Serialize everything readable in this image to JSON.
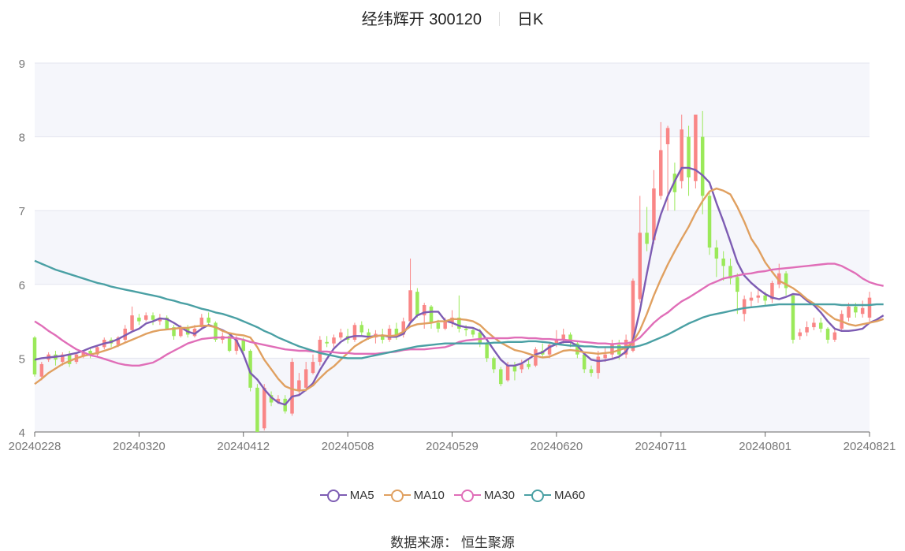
{
  "title": {
    "name": "经纬辉开 300120",
    "period": "日K"
  },
  "source": "数据来源： 恒生聚源",
  "colors": {
    "up": "#f98686",
    "down": "#9be95a",
    "MA5": "#7d5cb3",
    "MA10": "#e0a060",
    "MA30": "#e06eb8",
    "MA60": "#4aa0a4"
  },
  "chart_data": {
    "type": "candlestick",
    "ylim": [
      4,
      9
    ],
    "yticks": [
      "4",
      "5",
      "6",
      "7",
      "8",
      "9"
    ],
    "xtick_labels": [
      "20240228",
      "20240320",
      "20240412",
      "20240508",
      "20240529",
      "20240620",
      "20240711",
      "20240801",
      "20240821"
    ],
    "xtick_index": [
      0,
      15,
      30,
      45,
      60,
      75,
      90,
      105,
      120
    ],
    "legend": [
      "MA5",
      "MA10",
      "MA30",
      "MA60"
    ],
    "candles": [
      [
        5.28,
        4.78,
        5.3,
        4.75
      ],
      [
        4.75,
        4.92,
        4.95,
        4.7
      ],
      [
        4.98,
        5.05,
        5.08,
        4.95
      ],
      [
        5.05,
        4.98,
        5.1,
        4.9
      ],
      [
        4.95,
        5.05,
        5.08,
        4.9
      ],
      [
        5.05,
        4.92,
        5.1,
        4.88
      ],
      [
        4.95,
        5.05,
        5.08,
        4.92
      ],
      [
        5.02,
        5.08,
        5.1,
        5.0
      ],
      [
        5.1,
        5.05,
        5.15,
        5.0
      ],
      [
        5.05,
        5.15,
        5.18,
        5.02
      ],
      [
        5.15,
        5.25,
        5.28,
        5.12
      ],
      [
        5.25,
        5.2,
        5.28,
        5.15
      ],
      [
        5.18,
        5.28,
        5.3,
        5.15
      ],
      [
        5.25,
        5.4,
        5.45,
        5.22
      ],
      [
        5.38,
        5.58,
        5.7,
        5.35
      ],
      [
        5.55,
        5.5,
        5.6,
        5.45
      ],
      [
        5.52,
        5.58,
        5.62,
        5.5
      ],
      [
        5.58,
        5.52,
        5.62,
        5.45
      ],
      [
        5.5,
        5.55,
        5.6,
        5.45
      ],
      [
        5.55,
        5.4,
        5.58,
        5.38
      ],
      [
        5.42,
        5.3,
        5.45,
        5.25
      ],
      [
        5.3,
        5.4,
        5.45,
        5.28
      ],
      [
        5.4,
        5.32,
        5.45,
        5.28
      ],
      [
        5.3,
        5.4,
        5.45,
        5.28
      ],
      [
        5.42,
        5.55,
        5.6,
        5.4
      ],
      [
        5.55,
        5.48,
        5.62,
        5.45
      ],
      [
        5.48,
        5.25,
        5.5,
        5.22
      ],
      [
        5.25,
        5.3,
        5.35,
        5.2
      ],
      [
        5.3,
        5.1,
        5.32,
        5.08
      ],
      [
        5.1,
        5.25,
        5.3,
        5.05
      ],
      [
        5.25,
        5.1,
        5.28,
        5.05
      ],
      [
        5.1,
        4.6,
        5.12,
        4.55
      ],
      [
        4.6,
        4.0,
        4.65,
        3.95
      ],
      [
        4.05,
        4.6,
        4.65,
        4.02
      ],
      [
        4.5,
        4.4,
        4.55,
        4.35
      ],
      [
        4.4,
        4.45,
        4.5,
        4.38
      ],
      [
        4.45,
        4.28,
        4.5,
        4.25
      ],
      [
        4.25,
        4.95,
        5.0,
        4.22
      ],
      [
        4.55,
        4.7,
        4.8,
        4.5
      ],
      [
        4.6,
        4.85,
        4.95,
        4.55
      ],
      [
        4.8,
        4.95,
        5.05,
        4.78
      ],
      [
        4.95,
        5.25,
        5.3,
        4.9
      ],
      [
        5.22,
        5.2,
        5.3,
        5.15
      ],
      [
        5.2,
        5.28,
        5.32,
        5.15
      ],
      [
        5.28,
        5.35,
        5.4,
        5.25
      ],
      [
        5.3,
        5.25,
        5.4,
        5.2
      ],
      [
        5.25,
        5.45,
        5.48,
        5.22
      ],
      [
        5.45,
        5.35,
        5.5,
        5.3
      ],
      [
        5.35,
        5.28,
        5.4,
        5.25
      ],
      [
        5.28,
        5.33,
        5.38,
        5.2
      ],
      [
        5.3,
        5.25,
        5.4,
        5.2
      ],
      [
        5.25,
        5.4,
        5.45,
        5.22
      ],
      [
        5.4,
        5.3,
        5.48,
        5.25
      ],
      [
        5.32,
        5.5,
        5.55,
        5.28
      ],
      [
        5.5,
        5.92,
        6.35,
        5.48
      ],
      [
        5.9,
        5.58,
        5.95,
        5.55
      ],
      [
        5.58,
        5.72,
        5.75,
        5.4
      ],
      [
        5.7,
        5.48,
        5.72,
        5.4
      ],
      [
        5.48,
        5.4,
        5.52,
        5.35
      ],
      [
        5.4,
        5.5,
        5.55,
        5.38
      ],
      [
        5.48,
        5.55,
        5.65,
        5.42
      ],
      [
        5.55,
        5.4,
        5.85,
        5.35
      ],
      [
        5.4,
        5.38,
        5.45,
        5.3
      ],
      [
        5.38,
        5.32,
        5.42,
        5.28
      ],
      [
        5.35,
        5.2,
        5.4,
        5.15
      ],
      [
        5.2,
        5.0,
        5.22,
        4.95
      ],
      [
        5.0,
        4.85,
        5.02,
        4.8
      ],
      [
        4.85,
        4.65,
        4.88,
        4.62
      ],
      [
        4.7,
        4.9,
        4.95,
        4.68
      ],
      [
        4.9,
        4.82,
        4.95,
        4.7
      ],
      [
        4.85,
        4.92,
        4.98,
        4.8
      ],
      [
        4.92,
        4.88,
        5.0,
        4.85
      ],
      [
        4.9,
        5.12,
        5.15,
        4.88
      ],
      [
        5.1,
        5.05,
        5.2,
        5.0
      ],
      [
        5.05,
        5.18,
        5.22,
        5.0
      ],
      [
        5.18,
        5.25,
        5.38,
        5.15
      ],
      [
        5.25,
        5.32,
        5.4,
        5.2
      ],
      [
        5.32,
        5.22,
        5.35,
        5.15
      ],
      [
        5.2,
        5.05,
        5.22,
        5.0
      ],
      [
        5.05,
        4.85,
        5.08,
        4.8
      ],
      [
        4.85,
        4.8,
        4.9,
        4.75
      ],
      [
        4.8,
        5.02,
        5.1,
        4.72
      ],
      [
        5.0,
        5.05,
        5.15,
        4.95
      ],
      [
        5.05,
        5.18,
        5.25,
        5.0
      ],
      [
        5.18,
        5.05,
        5.25,
        4.98
      ],
      [
        5.05,
        5.25,
        5.32,
        5.0
      ],
      [
        5.1,
        6.05,
        6.08,
        5.08
      ],
      [
        5.8,
        6.7,
        7.2,
        5.75
      ],
      [
        6.7,
        6.55,
        7.05,
        6.45
      ],
      [
        6.6,
        7.3,
        7.55,
        6.55
      ],
      [
        7.2,
        7.82,
        8.2,
        7.15
      ],
      [
        7.9,
        8.12,
        8.15,
        7.0
      ],
      [
        7.5,
        7.25,
        7.65,
        7.0
      ],
      [
        7.4,
        8.1,
        8.3,
        7.3
      ],
      [
        8.0,
        7.45,
        8.15,
        7.2
      ],
      [
        7.4,
        8.3,
        8.3,
        7.3
      ],
      [
        8.0,
        7.2,
        8.35,
        6.95
      ],
      [
        7.2,
        6.5,
        7.25,
        6.4
      ],
      [
        6.5,
        6.35,
        6.6,
        6.1
      ],
      [
        6.35,
        6.25,
        6.45,
        6.05
      ],
      [
        6.25,
        6.08,
        6.35,
        6.0
      ],
      [
        6.1,
        5.9,
        6.15,
        5.6
      ],
      [
        5.6,
        5.8,
        5.85,
        5.5
      ],
      [
        5.78,
        5.82,
        5.9,
        5.7
      ],
      [
        5.82,
        5.85,
        5.95,
        5.75
      ],
      [
        5.85,
        5.78,
        5.9,
        5.7
      ],
      [
        5.8,
        6.02,
        6.05,
        5.75
      ],
      [
        6.0,
        6.15,
        6.28,
        5.95
      ],
      [
        6.15,
        5.95,
        6.18,
        5.85
      ],
      [
        5.85,
        5.25,
        5.88,
        5.2
      ],
      [
        5.3,
        5.35,
        5.4,
        5.25
      ],
      [
        5.35,
        5.42,
        5.5,
        5.3
      ],
      [
        5.42,
        5.48,
        5.55,
        5.38
      ],
      [
        5.48,
        5.4,
        5.55,
        5.35
      ],
      [
        5.4,
        5.25,
        5.42,
        5.2
      ],
      [
        5.25,
        5.35,
        5.4,
        5.22
      ],
      [
        5.4,
        5.6,
        5.65,
        5.38
      ],
      [
        5.55,
        5.7,
        5.75,
        5.5
      ],
      [
        5.7,
        5.62,
        5.75,
        5.55
      ],
      [
        5.6,
        5.68,
        5.78,
        5.55
      ],
      [
        5.55,
        5.82,
        5.9,
        5.5
      ]
    ],
    "MA5": [
      4.98,
      5.0,
      5.01,
      5.02,
      5.03,
      5.05,
      5.07,
      5.1,
      5.14,
      5.17,
      5.2,
      5.22,
      5.26,
      5.31,
      5.36,
      5.4,
      5.47,
      5.5,
      5.54,
      5.53,
      5.48,
      5.42,
      5.36,
      5.33,
      5.4,
      5.45,
      5.42,
      5.38,
      5.33,
      5.24,
      5.05,
      4.8,
      4.71,
      4.58,
      4.47,
      4.4,
      4.37,
      4.48,
      4.5,
      4.57,
      4.66,
      4.84,
      4.99,
      5.13,
      5.22,
      5.28,
      5.3,
      5.3,
      5.29,
      5.3,
      5.31,
      5.29,
      5.29,
      5.33,
      5.48,
      5.58,
      5.62,
      5.63,
      5.63,
      5.51,
      5.48,
      5.44,
      5.42,
      5.41,
      5.37,
      5.25,
      5.11,
      4.98,
      4.9,
      4.9,
      4.93,
      4.99,
      5.05,
      5.08,
      5.15,
      5.19,
      5.22,
      5.22,
      5.17,
      5.06,
      4.98,
      4.96,
      4.97,
      4.99,
      5.02,
      5.09,
      5.24,
      5.65,
      6.15,
      6.62,
      6.95,
      7.2,
      7.4,
      7.58,
      7.58,
      7.55,
      7.48,
      7.38,
      7.1,
      6.85,
      6.58,
      6.3,
      6.12,
      6.02,
      5.94,
      5.87,
      5.82,
      5.8,
      5.83,
      5.87,
      5.86,
      5.78,
      5.72,
      5.62,
      5.5,
      5.4,
      5.37,
      5.37,
      5.38,
      5.4,
      5.48,
      5.52,
      5.58
    ],
    "MA10": [
      4.65,
      4.72,
      4.8,
      4.86,
      4.92,
      4.96,
      5.0,
      5.03,
      5.05,
      5.07,
      5.1,
      5.13,
      5.17,
      5.21,
      5.25,
      5.29,
      5.33,
      5.36,
      5.38,
      5.39,
      5.4,
      5.41,
      5.41,
      5.43,
      5.44,
      5.44,
      5.42,
      5.37,
      5.34,
      5.32,
      5.31,
      5.28,
      5.15,
      4.98,
      4.85,
      4.72,
      4.62,
      4.58,
      4.56,
      4.57,
      4.63,
      4.73,
      4.82,
      4.89,
      4.98,
      5.07,
      5.16,
      5.22,
      5.27,
      5.3,
      5.31,
      5.3,
      5.31,
      5.36,
      5.43,
      5.46,
      5.47,
      5.48,
      5.5,
      5.5,
      5.53,
      5.53,
      5.52,
      5.5,
      5.45,
      5.36,
      5.28,
      5.21,
      5.16,
      5.11,
      5.09,
      5.06,
      5.03,
      5.01,
      5.02,
      5.06,
      5.1,
      5.11,
      5.1,
      5.08,
      5.07,
      5.06,
      5.07,
      5.08,
      5.11,
      5.14,
      5.22,
      5.38,
      5.6,
      5.85,
      6.07,
      6.27,
      6.45,
      6.62,
      6.78,
      6.97,
      7.13,
      7.26,
      7.3,
      7.27,
      7.22,
      7.05,
      6.85,
      6.62,
      6.48,
      6.3,
      6.17,
      6.05,
      6.0,
      5.95,
      5.88,
      5.8,
      5.74,
      5.68,
      5.6,
      5.53,
      5.5,
      5.46,
      5.44,
      5.46,
      5.48,
      5.5,
      5.53
    ],
    "MA30": [
      5.5,
      5.44,
      5.37,
      5.31,
      5.24,
      5.18,
      5.12,
      5.08,
      5.04,
      5.02,
      4.99,
      4.96,
      4.93,
      4.91,
      4.9,
      4.9,
      4.92,
      4.94,
      4.99,
      5.05,
      5.1,
      5.15,
      5.2,
      5.23,
      5.26,
      5.27,
      5.28,
      5.28,
      5.28,
      5.27,
      5.25,
      5.22,
      5.2,
      5.18,
      5.16,
      5.14,
      5.12,
      5.11,
      5.1,
      5.1,
      5.09,
      5.09,
      5.09,
      5.08,
      5.07,
      5.07,
      5.06,
      5.06,
      5.06,
      5.06,
      5.07,
      5.08,
      5.09,
      5.11,
      5.12,
      5.12,
      5.12,
      5.13,
      5.14,
      5.15,
      5.18,
      5.22,
      5.24,
      5.25,
      5.26,
      5.27,
      5.27,
      5.27,
      5.27,
      5.28,
      5.28,
      5.27,
      5.27,
      5.26,
      5.26,
      5.25,
      5.25,
      5.24,
      5.23,
      5.22,
      5.21,
      5.2,
      5.2,
      5.19,
      5.2,
      5.2,
      5.22,
      5.28,
      5.38,
      5.48,
      5.56,
      5.62,
      5.7,
      5.77,
      5.82,
      5.88,
      5.94,
      6.0,
      6.04,
      6.08,
      6.1,
      6.12,
      6.14,
      6.15,
      6.17,
      6.18,
      6.2,
      6.21,
      6.22,
      6.23,
      6.24,
      6.25,
      6.26,
      6.27,
      6.28,
      6.28,
      6.25,
      6.2,
      6.15,
      6.08,
      6.03,
      6.0,
      5.98
    ],
    "MA60": [
      6.32,
      6.28,
      6.24,
      6.2,
      6.17,
      6.14,
      6.11,
      6.08,
      6.05,
      6.02,
      6.0,
      5.97,
      5.95,
      5.93,
      5.91,
      5.89,
      5.87,
      5.85,
      5.83,
      5.8,
      5.78,
      5.75,
      5.73,
      5.7,
      5.67,
      5.65,
      5.62,
      5.6,
      5.57,
      5.54,
      5.5,
      5.46,
      5.42,
      5.37,
      5.33,
      5.28,
      5.24,
      5.2,
      5.16,
      5.13,
      5.1,
      5.07,
      5.05,
      5.03,
      5.01,
      5.0,
      5.0,
      5.0,
      5.02,
      5.04,
      5.06,
      5.08,
      5.1,
      5.12,
      5.14,
      5.16,
      5.17,
      5.18,
      5.19,
      5.2,
      5.2,
      5.2,
      5.2,
      5.2,
      5.2,
      5.2,
      5.21,
      5.21,
      5.22,
      5.22,
      5.22,
      5.23,
      5.23,
      5.22,
      5.21,
      5.19,
      5.18,
      5.17,
      5.17,
      5.16,
      5.16,
      5.15,
      5.15,
      5.15,
      5.15,
      5.15,
      5.15,
      5.17,
      5.2,
      5.24,
      5.28,
      5.32,
      5.37,
      5.42,
      5.47,
      5.51,
      5.55,
      5.58,
      5.6,
      5.62,
      5.64,
      5.66,
      5.68,
      5.69,
      5.7,
      5.71,
      5.72,
      5.73,
      5.73,
      5.73,
      5.73,
      5.73,
      5.73,
      5.73,
      5.73,
      5.73,
      5.72,
      5.72,
      5.72,
      5.72,
      5.72,
      5.73,
      5.73
    ]
  }
}
